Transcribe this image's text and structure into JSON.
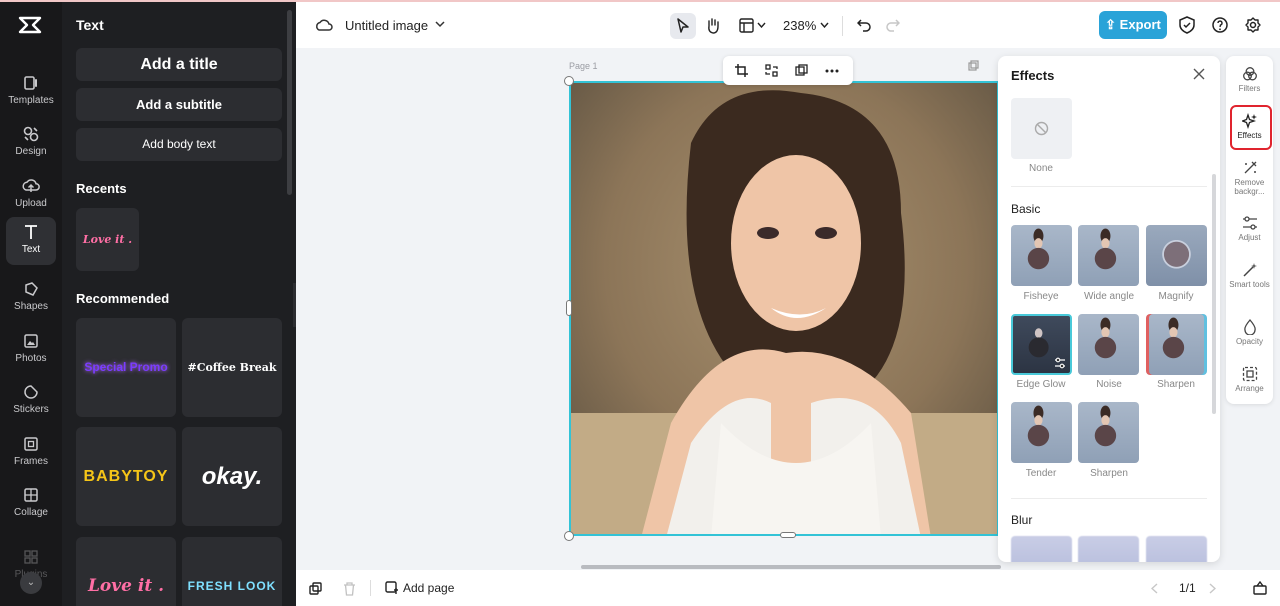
{
  "rail": {
    "items": [
      {
        "label": "Templates",
        "icon": "templates-icon"
      },
      {
        "label": "Design",
        "icon": "design-icon"
      },
      {
        "label": "Upload",
        "icon": "upload-icon"
      },
      {
        "label": "Text",
        "icon": "text-icon"
      },
      {
        "label": "Shapes",
        "icon": "shapes-icon"
      },
      {
        "label": "Photos",
        "icon": "photos-icon"
      },
      {
        "label": "Stickers",
        "icon": "stickers-icon"
      },
      {
        "label": "Frames",
        "icon": "frames-icon"
      },
      {
        "label": "Collage",
        "icon": "collage-icon"
      },
      {
        "label": "Plugins",
        "icon": "plugins-icon"
      }
    ]
  },
  "text_panel": {
    "title": "Text",
    "add_title": "Add a title",
    "add_subtitle": "Add a subtitle",
    "add_body": "Add body text",
    "recents_label": "Recents",
    "recent_item": "Love it .",
    "recommended_label": "Recommended",
    "cards": [
      "Special Promo",
      "#Coffee Break",
      "BABYTOY",
      "okay.",
      "Love it .",
      "FRESH LOOK"
    ]
  },
  "topbar": {
    "doc_title": "Untitled image",
    "zoom": "238%",
    "export_label": "Export"
  },
  "canvas": {
    "page_label": "Page 1"
  },
  "effects": {
    "title": "Effects",
    "none_label": "None",
    "basic_label": "Basic",
    "basic_items": [
      "Fisheye",
      "Wide angle",
      "Magnify",
      "Edge Glow",
      "Noise",
      "Sharpen",
      "Tender",
      "Sharpen"
    ],
    "blur_label": "Blur"
  },
  "right_rail": {
    "items": [
      "Filters",
      "Effects",
      "Remove backgr...",
      "Adjust",
      "Smart tools",
      "Opacity",
      "Arrange"
    ]
  },
  "bottom": {
    "add_page": "Add page",
    "pager": "1/1"
  },
  "colors": {
    "accent": "#2aa3d8",
    "selection": "#33c3d6",
    "highlight": "#e0242e"
  }
}
